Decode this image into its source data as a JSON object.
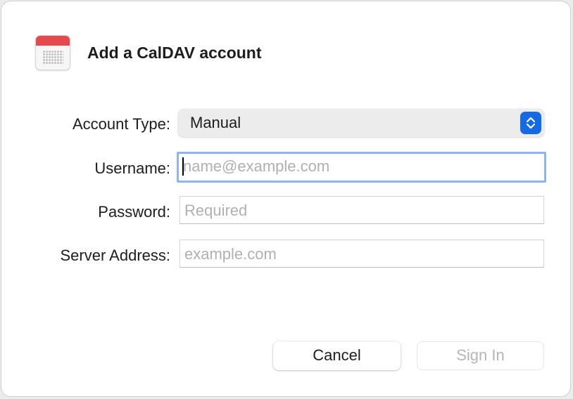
{
  "dialog": {
    "title": "Add a CalDAV account",
    "icon": "calendar-icon"
  },
  "form": {
    "account_type": {
      "label": "Account Type:",
      "value": "Manual"
    },
    "username": {
      "label": "Username:",
      "value": "",
      "placeholder": "name@example.com"
    },
    "password": {
      "label": "Password:",
      "value": "",
      "placeholder": "Required"
    },
    "server_address": {
      "label": "Server Address:",
      "value": "",
      "placeholder": "example.com"
    }
  },
  "buttons": {
    "cancel": "Cancel",
    "sign_in": "Sign In"
  },
  "colors": {
    "accent": "#1469e6",
    "focus_ring": "#8fb3f5",
    "calendar_red": "#e5484d"
  }
}
